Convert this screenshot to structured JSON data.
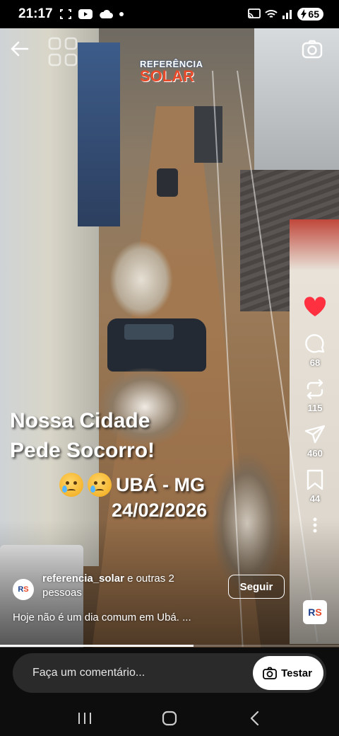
{
  "status_bar": {
    "time": "21:17",
    "battery": "65",
    "icons": [
      "screen-record-icon",
      "youtube-icon",
      "cloud-icon",
      "dot-icon",
      "cast-icon",
      "wifi-icon",
      "signal-icon",
      "battery-icon"
    ]
  },
  "video": {
    "watermark": {
      "line1": "REFERÊNCIA",
      "line2": "SOLAR"
    },
    "headline_line1": "Nossa Cidade",
    "headline_line2": "Pede Socorro!",
    "location": "UBÁ - MG",
    "date": "24/02/2026",
    "progress_fraction": 0.57
  },
  "actions": {
    "like_color": "#ff3040",
    "comments": "68",
    "reposts": "115",
    "shares": "460",
    "saves": "44"
  },
  "author": {
    "avatar_text": {
      "r": "R",
      "s": "S"
    },
    "name": "referencia_solar",
    "and_others": "e outras 2 pessoas",
    "follow_label": "Seguir",
    "caption": "Hoje não é um dia comum em Ubá. ..."
  },
  "comment_bar": {
    "placeholder": "Faça um comentário...",
    "test_label": "Testar"
  },
  "navbar": {
    "icons": [
      "recent-apps-icon",
      "home-icon",
      "back-icon"
    ]
  }
}
